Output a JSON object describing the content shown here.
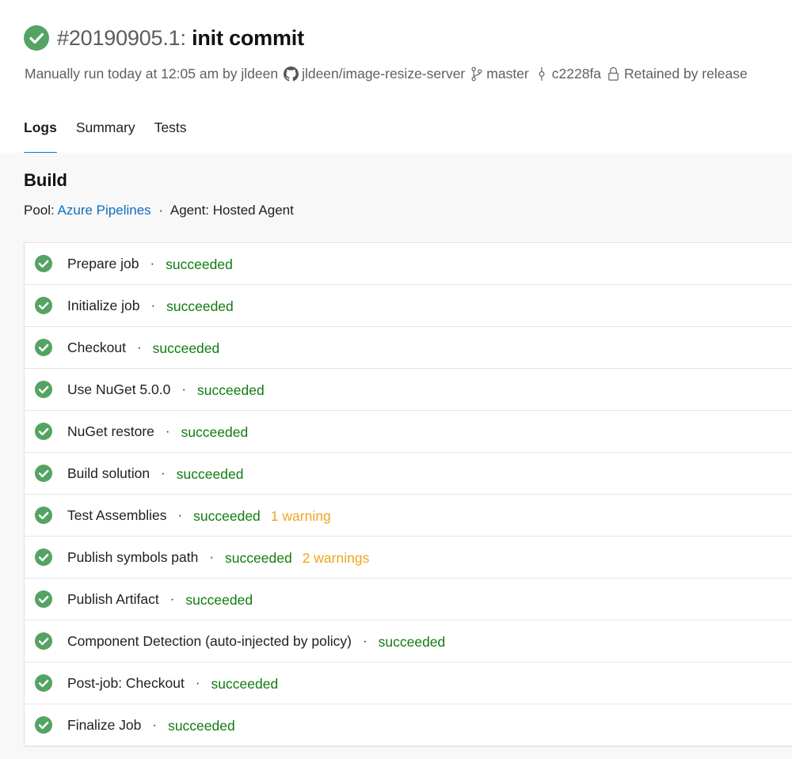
{
  "header": {
    "run_id": "#20190905.1:",
    "commit_message": "init commit",
    "manual_run_text": "Manually run today at 12:05 am by jldeen",
    "repo": "jldeen/image-resize-server",
    "branch": "master",
    "commit": "c2228fa",
    "retention": "Retained by release"
  },
  "tabs": [
    {
      "label": "Logs",
      "active": true
    },
    {
      "label": "Summary",
      "active": false
    },
    {
      "label": "Tests",
      "active": false
    }
  ],
  "build": {
    "title": "Build",
    "pool_label": "Pool:",
    "pool_value": "Azure Pipelines",
    "separator": "·",
    "agent_text": "Agent: Hosted Agent"
  },
  "jobs": [
    {
      "name": "Prepare job",
      "separator": "·",
      "status": "succeeded",
      "warning": ""
    },
    {
      "name": "Initialize job",
      "separator": "·",
      "status": "succeeded",
      "warning": ""
    },
    {
      "name": "Checkout",
      "separator": "·",
      "status": "succeeded",
      "warning": ""
    },
    {
      "name": "Use NuGet 5.0.0",
      "separator": "·",
      "status": "succeeded",
      "warning": ""
    },
    {
      "name": "NuGet restore",
      "separator": "·",
      "status": "succeeded",
      "warning": ""
    },
    {
      "name": "Build solution",
      "separator": "·",
      "status": "succeeded",
      "warning": ""
    },
    {
      "name": "Test Assemblies",
      "separator": "·",
      "status": "succeeded",
      "warning": "1 warning"
    },
    {
      "name": "Publish symbols path",
      "separator": "·",
      "status": "succeeded",
      "warning": "2 warnings"
    },
    {
      "name": "Publish Artifact",
      "separator": "·",
      "status": "succeeded",
      "warning": ""
    },
    {
      "name": "Component Detection (auto-injected by policy)",
      "separator": "·",
      "status": "succeeded",
      "warning": ""
    },
    {
      "name": "Post-job: Checkout",
      "separator": "·",
      "status": "succeeded",
      "warning": ""
    },
    {
      "name": "Finalize Job",
      "separator": "·",
      "status": "succeeded",
      "warning": ""
    }
  ],
  "colors": {
    "success": "#107c10",
    "success_icon": "#55a362",
    "warning": "#f2a41d",
    "link": "#106ebe",
    "tab_underline": "#0078d4"
  },
  "icons": {
    "run_status": "check-circle-icon",
    "repo": "github-icon",
    "branch": "branch-icon",
    "commit": "commit-icon",
    "retention": "lock-icon"
  }
}
